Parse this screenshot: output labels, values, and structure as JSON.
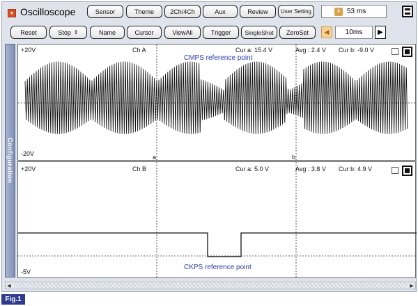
{
  "app": {
    "title": "Oscilloscope",
    "icon": "dropdown-arrow-icon"
  },
  "toolbar1": {
    "buttons": [
      "Sensor",
      "Theme",
      "2Ch/4Ch",
      "Aux",
      "Review",
      "User Setting"
    ],
    "readout_value": "53 ms",
    "readout_icon": "hourglass-icon",
    "menu_icon": "menu-icon"
  },
  "toolbar2": {
    "buttons": [
      "Reset",
      "Stop",
      "Name",
      "Cursor",
      "ViewAll",
      "Trigger",
      "SingleShot",
      "ZeroSet"
    ],
    "stop_stepper": "⇕",
    "speaker_icon": "speaker-icon",
    "timebase": "10ms",
    "play_icon": "play-icon"
  },
  "side_tab": "Configuration",
  "channel_a": {
    "scale_top": "+20V",
    "scale_bottom": "-20V",
    "name": "Ch A",
    "cur_a": "Cur a: 15.4 V",
    "avg": "Avg : 2.4 V",
    "cur_b": "Cur b: -9.0 V",
    "reference_label": "CMPS reference point",
    "marker_a": "a",
    "marker_b": "b"
  },
  "channel_b": {
    "scale_top": "+20V",
    "scale_bottom": "-5V",
    "name": "Ch B",
    "cur_a": "Cur a: 5.0 V",
    "avg": "Avg : 3.8 V",
    "cur_b": "Cur b: 4.9 V",
    "reference_label": "CKPS reference point"
  },
  "figure_label": "Fig.1",
  "colors": {
    "ref_text": "#2b3aa6",
    "fig_badge": "#2e3b8f",
    "side_tab": "#7f8fb6"
  }
}
